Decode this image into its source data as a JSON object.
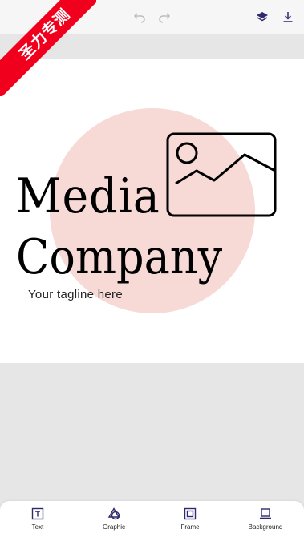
{
  "watermark": {
    "text": "圣力专测",
    "color": "#f0001d"
  },
  "toolbar": {
    "icons": [
      "undo-icon",
      "redo-icon",
      "layers-icon",
      "download-icon"
    ]
  },
  "canvas": {
    "logo_line1": "Media",
    "logo_line2": "Company",
    "tagline": "Your tagline here",
    "circle_color": "#f7d9d6",
    "graphic_icon": "image-icon"
  },
  "bottom_nav": {
    "items": [
      {
        "label": "Text",
        "icon": "text-icon"
      },
      {
        "label": "Graphic",
        "icon": "shapes-icon"
      },
      {
        "label": "Frame",
        "icon": "frame-icon"
      },
      {
        "label": "Background",
        "icon": "laptop-icon"
      }
    ],
    "accent": "#2e2a6b"
  }
}
